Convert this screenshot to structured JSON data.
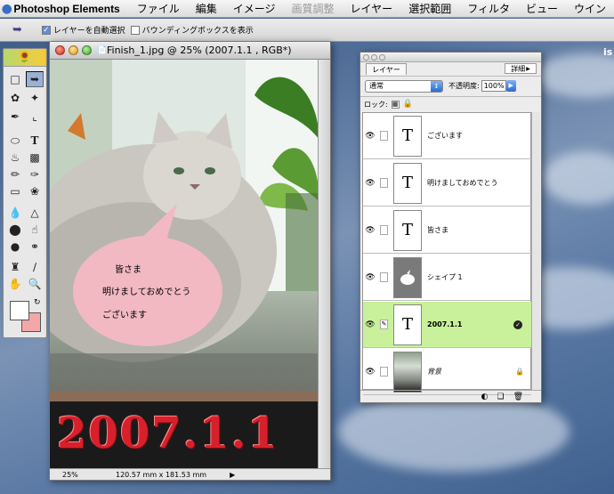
{
  "menubar": {
    "apple": "",
    "app_name": "Photoshop Elements",
    "items": [
      "ファイル",
      "編集",
      "イメージ",
      "画質調整",
      "レイヤー",
      "選択範囲",
      "フィルタ",
      "ビュー",
      "ウイン"
    ],
    "disabled_item": "画質調整"
  },
  "options_bar": {
    "tool_icon": "move-tool-icon",
    "auto_select_label": "レイヤーを自動選択",
    "auto_select_checked": true,
    "bounding_box_label": "バウンディングボックスを表示",
    "bounding_box_checked": false
  },
  "document": {
    "title": "Finish_1.jpg @ 25% (2007.1.1 , RGB*)",
    "speech_bubble": {
      "line1": "皆さま",
      "line2": "明けましておめでとう",
      "line3": "ございます"
    },
    "big_text": "2007.1.1",
    "zoom": "25%",
    "dimensions": "120.57 mm x 181.53 mm",
    "colors": {
      "bubble": "#f2b9c2",
      "big_text": "#d8202c"
    }
  },
  "toolbox": {
    "foreground_color": "#ffffff",
    "background_color": "#f2a8a8"
  },
  "layers_panel": {
    "tab_label": "レイヤー",
    "details_label": "詳細",
    "blend_mode": "通常",
    "opacity_label": "不透明度:",
    "opacity_value": "100%",
    "lock_label": "ロック:",
    "layers": [
      {
        "name": "ございます",
        "thumb": "T",
        "active": false
      },
      {
        "name": "明けましておめでとう",
        "thumb": "T",
        "active": false
      },
      {
        "name": "皆さま",
        "thumb": "T",
        "active": false
      },
      {
        "name": "シェイプ 1",
        "thumb": "shape",
        "active": false
      },
      {
        "name": "2007.1.1",
        "thumb": "T",
        "active": true
      },
      {
        "name": "背景",
        "thumb": "photo",
        "active": false
      }
    ],
    "active_color": "#c9f09a"
  },
  "desktop": {
    "partial_text": "is"
  }
}
